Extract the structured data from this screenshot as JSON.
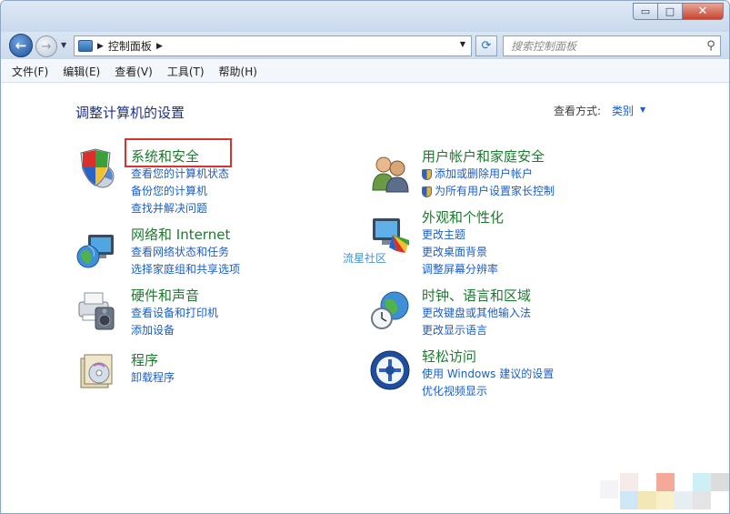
{
  "window": {
    "caption_buttons": {
      "minimize": "▭",
      "maximize": "□",
      "close": "✕"
    }
  },
  "address_bar": {
    "path": "控制面板",
    "search_placeholder": "搜索控制面板"
  },
  "menu": [
    "文件(F)",
    "编辑(E)",
    "查看(V)",
    "工具(T)",
    "帮助(H)"
  ],
  "content": {
    "heading": "调整计算机的设置",
    "view_by_label": "查看方式:",
    "view_by_value": "类别"
  },
  "categories": [
    {
      "title": "系统和安全",
      "links": [
        "查看您的计算机状态",
        "备份您的计算机",
        "查找并解决问题"
      ]
    },
    {
      "title": "网络和 Internet",
      "links": [
        "查看网络状态和任务",
        "选择家庭组和共享选项"
      ]
    },
    {
      "title": "硬件和声音",
      "links": [
        "查看设备和打印机",
        "添加设备"
      ]
    },
    {
      "title": "程序",
      "links": [
        "卸载程序"
      ]
    },
    {
      "title": "用户帐户和家庭安全",
      "links": [
        "添加或删除用户帐户",
        "为所有用户设置家长控制"
      ]
    },
    {
      "title": "外观和个性化",
      "links": [
        "更改主题",
        "更改桌面背景",
        "调整屏幕分辨率"
      ]
    },
    {
      "title": "时钟、语言和区域",
      "links": [
        "更改键盘或其他输入法",
        "更改显示语言"
      ]
    },
    {
      "title": "轻松访问",
      "links": [
        "使用 Windows 建议的设置",
        "优化视频显示"
      ]
    }
  ],
  "watermark": "流星社区",
  "colors": {
    "category_title": "#1d7a2e",
    "link": "#1c5ec9",
    "heading": "#1e3287",
    "highlight_box": "#d8332f"
  }
}
